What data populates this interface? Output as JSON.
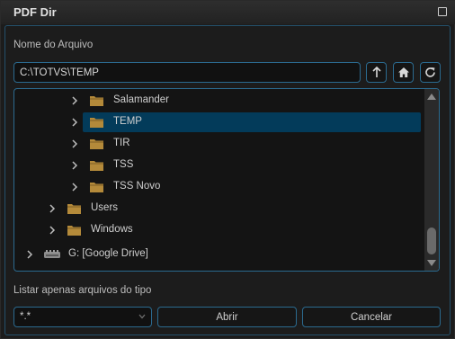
{
  "window": {
    "title": "PDF Dir"
  },
  "file": {
    "label": "Nome do Arquivo",
    "path": "C:\\TOTVS\\TEMP"
  },
  "tree": {
    "items": [
      {
        "label": "Salamander",
        "selected": false
      },
      {
        "label": "TEMP",
        "selected": true
      },
      {
        "label": "TIR",
        "selected": false
      },
      {
        "label": "TSS",
        "selected": false
      },
      {
        "label": "TSS Novo",
        "selected": false
      },
      {
        "label": "Users",
        "selected": false
      },
      {
        "label": "Windows",
        "selected": false
      },
      {
        "label": "G: [Google Drive]",
        "selected": false
      }
    ]
  },
  "filter": {
    "label": "Listar apenas arquivos do tipo",
    "value": "*.*"
  },
  "buttons": {
    "open": "Abrir",
    "cancel": "Cancelar"
  },
  "colors": {
    "accent": "#2b6a8f",
    "selection": "#033b5a",
    "folder": "#b48a3a"
  }
}
